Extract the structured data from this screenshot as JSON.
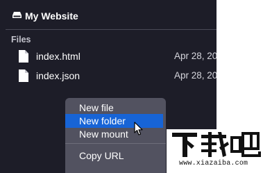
{
  "header": {
    "title": "My Website",
    "icon": "drive-icon"
  },
  "files_section": {
    "label": "Files",
    "items": [
      {
        "name": "index.html",
        "date": "Apr 28, 20",
        "icon": "file-icon"
      },
      {
        "name": "index.json",
        "date": "Apr 28, 20",
        "icon": "file-icon"
      }
    ]
  },
  "context_menu": {
    "items": [
      {
        "label": "New file",
        "selected": false
      },
      {
        "label": "New folder",
        "selected": true
      },
      {
        "label": "New mount",
        "selected": false
      },
      {
        "label": "Copy URL",
        "selected": false
      }
    ]
  },
  "watermark": {
    "logo_text": "下载吧",
    "url": "www.xiazaiba.com"
  },
  "colors": {
    "window_bg": "#1d1d28",
    "menu_bg": "#525260",
    "menu_selected": "#1764d6",
    "divider": "#4a4a56"
  }
}
